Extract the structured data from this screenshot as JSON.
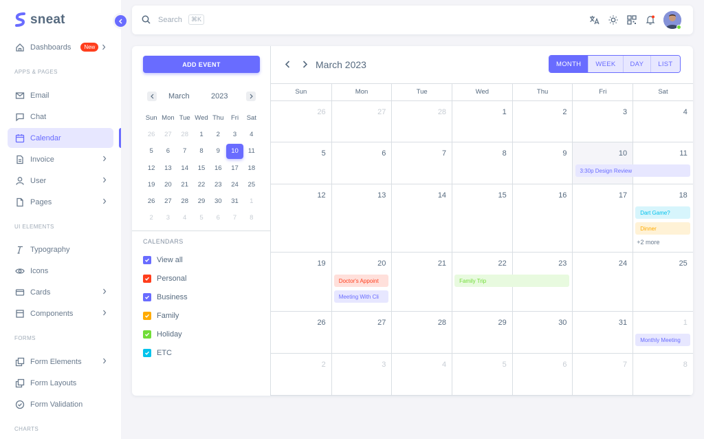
{
  "brand": {
    "name": "sneat",
    "color": "#696cff"
  },
  "sidebar": {
    "items": [
      {
        "label": "Dashboards",
        "icon": "home-icon",
        "badge": "New",
        "chevron": true
      },
      {
        "section": "APPS & PAGES"
      },
      {
        "label": "Email",
        "icon": "mail-icon"
      },
      {
        "label": "Chat",
        "icon": "chat-icon"
      },
      {
        "label": "Calendar",
        "icon": "calendar-icon",
        "active": true
      },
      {
        "label": "Invoice",
        "icon": "file-icon",
        "chevron": true
      },
      {
        "label": "User",
        "icon": "user-icon",
        "chevron": true
      },
      {
        "label": "Pages",
        "icon": "page-icon",
        "chevron": true
      },
      {
        "section": "UI ELEMENTS"
      },
      {
        "label": "Typography",
        "icon": "type-icon"
      },
      {
        "label": "Icons",
        "icon": "eye-icon"
      },
      {
        "label": "Cards",
        "icon": "card-icon",
        "chevron": true
      },
      {
        "label": "Components",
        "icon": "box-icon",
        "chevron": true
      },
      {
        "section": "FORMS"
      },
      {
        "label": "Form Elements",
        "icon": "copy-icon",
        "chevron": true
      },
      {
        "label": "Form Layouts",
        "icon": "copy-icon"
      },
      {
        "label": "Form Validation",
        "icon": "check-circle-icon"
      },
      {
        "section": "CHARTS"
      }
    ]
  },
  "topbar": {
    "search_placeholder": "Search",
    "shortcut": "⌘K",
    "icons": [
      "translate-icon",
      "sun-icon",
      "grid-icon",
      "bell-icon"
    ]
  },
  "left_panel": {
    "add_event": "ADD EVENT",
    "mini_month": "March",
    "mini_year": "2023",
    "weekdays": [
      "Sun",
      "Mon",
      "Tue",
      "Wed",
      "Thu",
      "Fri",
      "Sat"
    ],
    "weeks": [
      [
        [
          "26",
          1
        ],
        [
          "27",
          1
        ],
        [
          "28",
          1
        ],
        [
          "1",
          0
        ],
        [
          "2",
          0
        ],
        [
          "3",
          0
        ],
        [
          "4",
          0
        ]
      ],
      [
        [
          "5",
          0
        ],
        [
          "6",
          0
        ],
        [
          "7",
          0
        ],
        [
          "8",
          0
        ],
        [
          "9",
          0
        ],
        [
          "10",
          2
        ],
        [
          "11",
          0
        ]
      ],
      [
        [
          "12",
          0
        ],
        [
          "13",
          0
        ],
        [
          "14",
          0
        ],
        [
          "15",
          0
        ],
        [
          "16",
          0
        ],
        [
          "17",
          0
        ],
        [
          "18",
          0
        ]
      ],
      [
        [
          "19",
          0
        ],
        [
          "20",
          0
        ],
        [
          "21",
          0
        ],
        [
          "22",
          0
        ],
        [
          "23",
          0
        ],
        [
          "24",
          0
        ],
        [
          "25",
          0
        ]
      ],
      [
        [
          "26",
          0
        ],
        [
          "27",
          0
        ],
        [
          "28",
          0
        ],
        [
          "29",
          0
        ],
        [
          "30",
          0
        ],
        [
          "31",
          0
        ],
        [
          "1",
          1
        ]
      ],
      [
        [
          "2",
          1
        ],
        [
          "3",
          1
        ],
        [
          "4",
          1
        ],
        [
          "5",
          1
        ],
        [
          "6",
          1
        ],
        [
          "7",
          1
        ],
        [
          "8",
          1
        ]
      ]
    ],
    "calendars_heading": "CALENDARS",
    "filters": [
      {
        "label": "View all",
        "color": "#696cff"
      },
      {
        "label": "Personal",
        "color": "#ff3e1d"
      },
      {
        "label": "Business",
        "color": "#696cff"
      },
      {
        "label": "Family",
        "color": "#ffab00"
      },
      {
        "label": "Holiday",
        "color": "#71dd37"
      },
      {
        "label": "ETC",
        "color": "#03c3ec"
      }
    ]
  },
  "calendar": {
    "title": "March 2023",
    "views": [
      {
        "label": "MONTH",
        "active": true
      },
      {
        "label": "WEEK"
      },
      {
        "label": "DAY"
      },
      {
        "label": "LIST"
      }
    ],
    "weekdays": [
      "Sun",
      "Mon",
      "Tue",
      "Wed",
      "Thu",
      "Fri",
      "Sat"
    ],
    "weeks": [
      [
        [
          "26",
          1
        ],
        [
          "27",
          1
        ],
        [
          "28",
          1
        ],
        [
          "1",
          0
        ],
        [
          "2",
          0
        ],
        [
          "3",
          0
        ],
        [
          "4",
          0
        ]
      ],
      [
        [
          "5",
          0
        ],
        [
          "6",
          0
        ],
        [
          "7",
          0
        ],
        [
          "8",
          0
        ],
        [
          "9",
          0
        ],
        [
          "10",
          2
        ],
        [
          "11",
          0
        ]
      ],
      [
        [
          "12",
          0
        ],
        [
          "13",
          0
        ],
        [
          "14",
          0
        ],
        [
          "15",
          0
        ],
        [
          "16",
          0
        ],
        [
          "17",
          0
        ],
        [
          "18",
          0
        ]
      ],
      [
        [
          "19",
          0
        ],
        [
          "20",
          0
        ],
        [
          "21",
          0
        ],
        [
          "22",
          0
        ],
        [
          "23",
          0
        ],
        [
          "24",
          0
        ],
        [
          "25",
          0
        ]
      ],
      [
        [
          "26",
          0
        ],
        [
          "27",
          0
        ],
        [
          "28",
          0
        ],
        [
          "29",
          0
        ],
        [
          "30",
          0
        ],
        [
          "31",
          0
        ],
        [
          "1",
          1
        ]
      ],
      [
        [
          "2",
          1
        ],
        [
          "3",
          1
        ],
        [
          "4",
          1
        ],
        [
          "5",
          1
        ],
        [
          "6",
          1
        ],
        [
          "7",
          1
        ],
        [
          "8",
          1
        ]
      ]
    ],
    "events": [
      {
        "text": "3:30p  Design Review",
        "week": 1,
        "day": 5,
        "span": 2,
        "slot": 0,
        "bg": "#e7e7ff",
        "fg": "#696cff"
      },
      {
        "text": "Dart Game?",
        "week": 2,
        "day": 6,
        "span": 1,
        "slot": 0,
        "bg": "#d7f5fc",
        "fg": "#03c3ec"
      },
      {
        "text": "Dinner",
        "week": 2,
        "day": 6,
        "span": 1,
        "slot": 1,
        "bg": "#fff2d6",
        "fg": "#ffab00"
      },
      {
        "text": "Doctor's Appoint",
        "week": 3,
        "day": 1,
        "span": 1,
        "slot": 0,
        "bg": "#ffe0db",
        "fg": "#ff3e1d"
      },
      {
        "text": "Meeting With Cli",
        "week": 3,
        "day": 1,
        "span": 1,
        "slot": 1,
        "bg": "#e7e7ff",
        "fg": "#696cff"
      },
      {
        "text": "Family Trip",
        "week": 3,
        "day": 3,
        "span": 2,
        "slot": 0,
        "bg": "#e8fadf",
        "fg": "#71dd37"
      },
      {
        "text": "Monthly Meeting",
        "week": 4,
        "day": 6,
        "span": 1,
        "slot": 0,
        "bg": "#e7e7ff",
        "fg": "#696cff"
      }
    ],
    "more": {
      "text": "+2 more",
      "week": 2,
      "day": 6
    }
  }
}
